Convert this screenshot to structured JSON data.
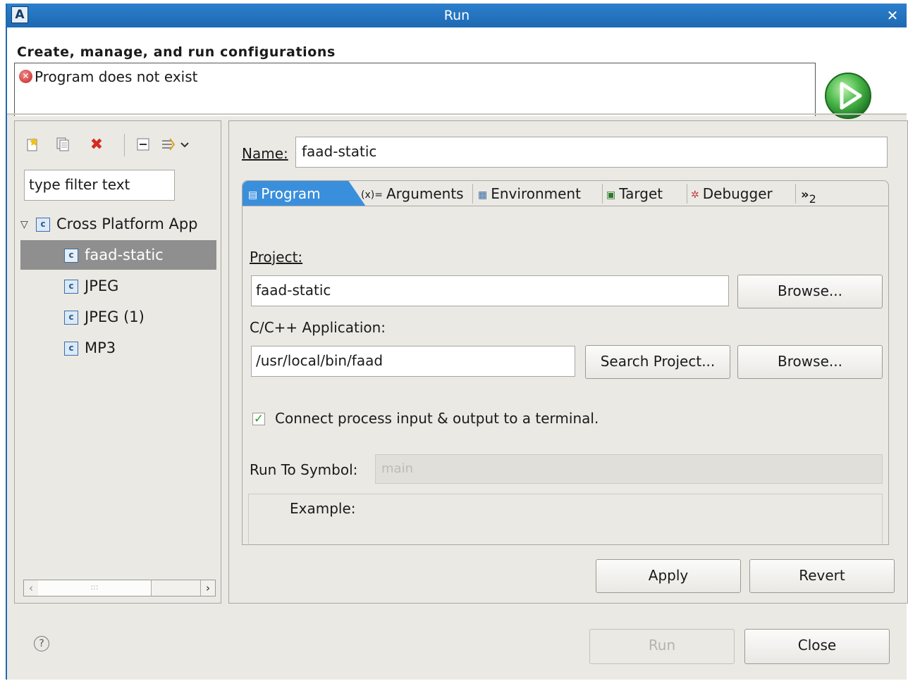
{
  "window": {
    "title": "Run",
    "close_glyph": "✕"
  },
  "header": {
    "title": "Create, manage, and run configurations",
    "message": "Program does not exist"
  },
  "left_panel": {
    "toolbar": [
      "new-config-icon",
      "duplicate-icon",
      "delete-icon",
      "collapse-all-icon",
      "filter-icon"
    ],
    "filter_placeholder": "type filter text",
    "tree": {
      "group": "Cross Platform App",
      "items": [
        "faad-static",
        "JPEG",
        "JPEG (1)",
        "MP3"
      ],
      "selected": "faad-static"
    }
  },
  "right_panel": {
    "name_label": "Name:",
    "name_value": "faad-static",
    "tabs": [
      {
        "label": "Program",
        "active": true
      },
      {
        "label": "Arguments"
      },
      {
        "label": "Environment"
      },
      {
        "label": "Target"
      },
      {
        "label": "Debugger"
      }
    ],
    "overflow_tabs": "2",
    "program": {
      "project_label": "Project:",
      "project_value": "faad-static",
      "browse_label": "Browse...",
      "app_label": "C/C++ Application:",
      "app_value": "/usr/local/bin/faad",
      "search_label": "Search Project...",
      "browse2_label": "Browse...",
      "terminal_label": "Connect process input & output to a terminal.",
      "terminal_checked": true,
      "symbol_label": "Run To Symbol:",
      "symbol_value": "main",
      "example_label": "Example:"
    },
    "apply_label": "Apply",
    "revert_label": "Revert"
  },
  "footer": {
    "run_label": "Run",
    "close_label": "Close"
  },
  "colors": {
    "titlebar": "#1e69b3",
    "active_tab": "#3a8fdc",
    "selected_row": "#8f8f8f",
    "error": "#c52222",
    "run_green": "#3aa63a"
  }
}
